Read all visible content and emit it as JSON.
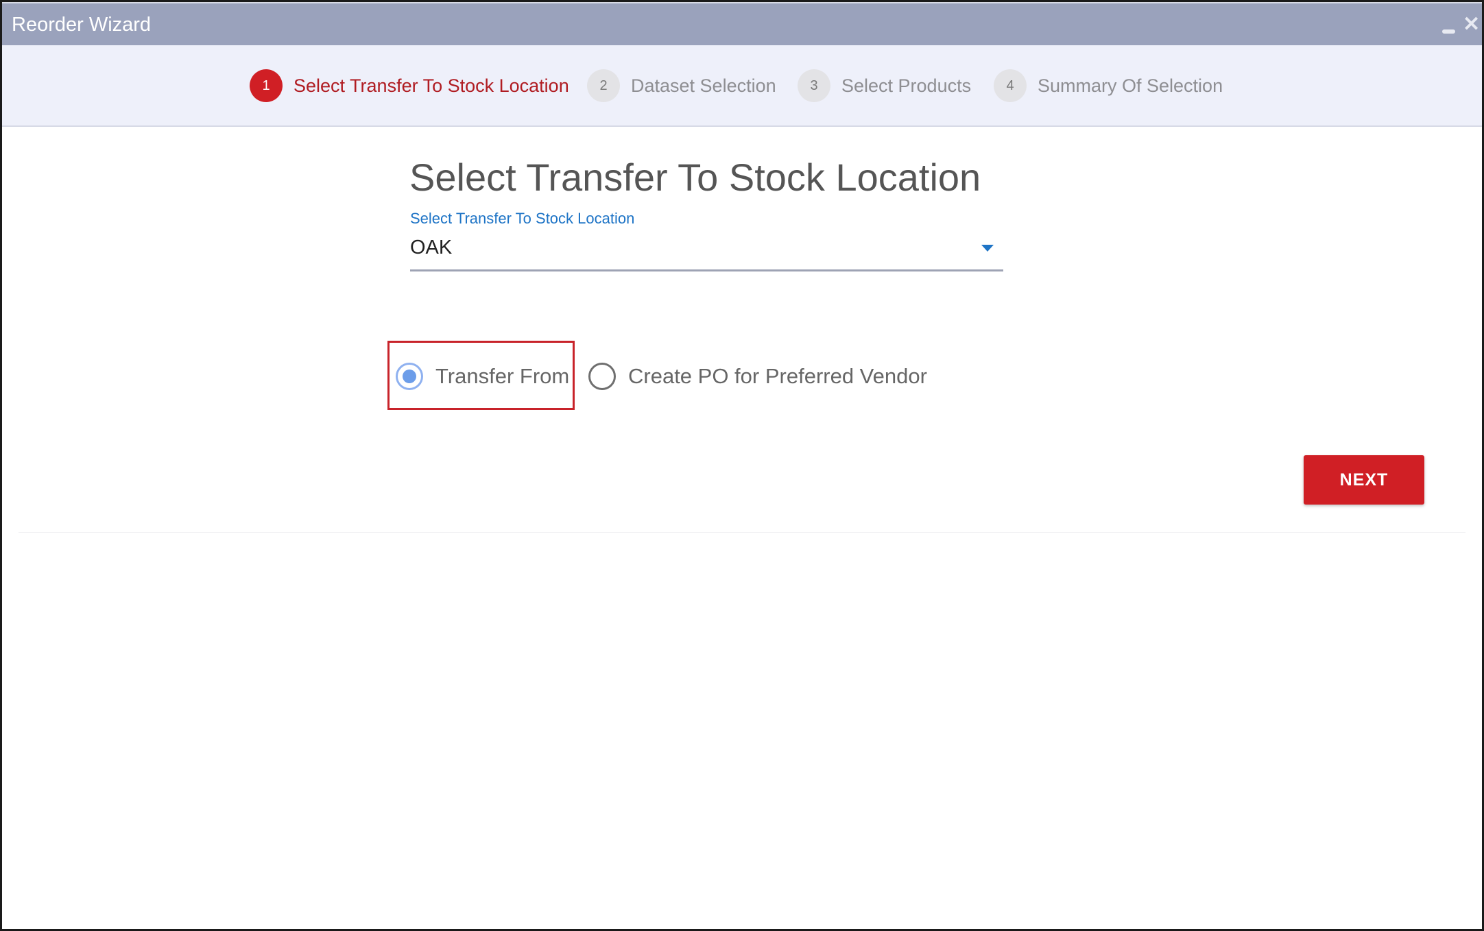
{
  "window": {
    "title": "Reorder Wizard",
    "minimize_icon": "minimize-icon",
    "close_icon": "close-icon",
    "close_glyph": "✕",
    "title_bar_color": "#9aa2bc"
  },
  "stepper": {
    "steps": [
      {
        "number": "1",
        "label": "Select Transfer To Stock Location",
        "state": "active"
      },
      {
        "number": "2",
        "label": "Dataset Selection",
        "state": "inactive"
      },
      {
        "number": "3",
        "label": "Select Products",
        "state": "inactive"
      },
      {
        "number": "4",
        "label": "Summary Of Selection",
        "state": "inactive"
      }
    ],
    "active_color": "#d01f25"
  },
  "main": {
    "heading": "Select Transfer To Stock Location",
    "location_select": {
      "label": "Select Transfer To Stock Location",
      "value": "OAK",
      "icon": "dropdown-caret-icon"
    },
    "options": [
      {
        "label": "Transfer From",
        "selected": true
      },
      {
        "label": "Create PO for Preferred Vendor",
        "selected": false
      }
    ],
    "next_button": {
      "label": "NEXT",
      "color": "#d01f25"
    }
  }
}
